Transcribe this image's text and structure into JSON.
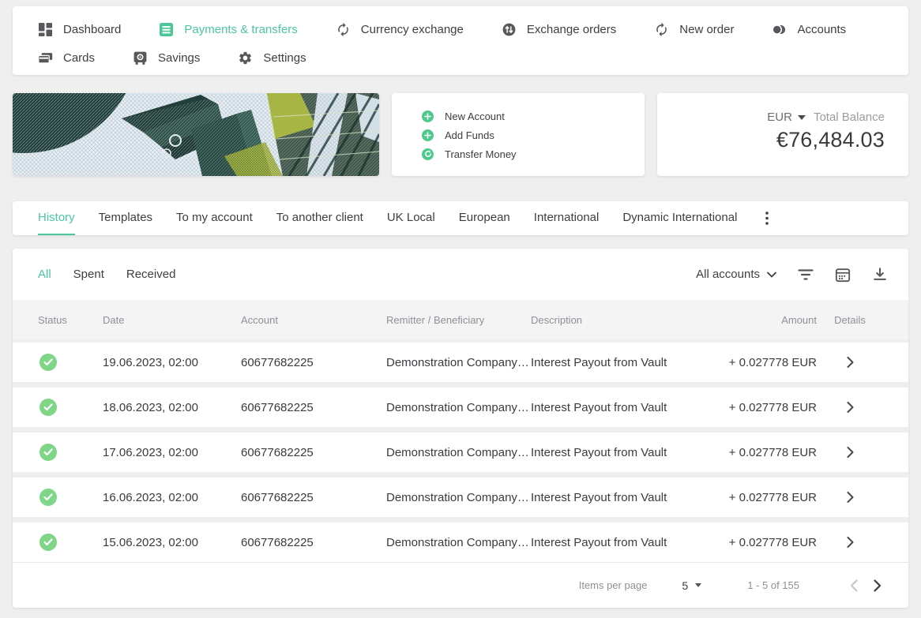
{
  "colors": {
    "accent_green": "#4cc6a0",
    "status_green": "#7fd687",
    "action_green": "#4ec98f",
    "dark_text": "#3e3e42",
    "muted_text": "#8f8f97",
    "page_bg": "#efeff0"
  },
  "nav": {
    "items": [
      {
        "label": "Dashboard",
        "icon": "dashboard-icon",
        "active": false
      },
      {
        "label": "Payments & transfers",
        "icon": "payments-icon",
        "active": true
      },
      {
        "label": "Currency exchange",
        "icon": "currency-exchange-icon",
        "active": false
      },
      {
        "label": "Exchange orders",
        "icon": "exchange-orders-icon",
        "active": false
      },
      {
        "label": "New order",
        "icon": "new-order-icon",
        "active": false
      },
      {
        "label": "Accounts",
        "icon": "accounts-icon",
        "active": false
      },
      {
        "label": "Cards",
        "icon": "cards-icon",
        "active": false
      },
      {
        "label": "Savings",
        "icon": "savings-icon",
        "active": false
      },
      {
        "label": "Settings",
        "icon": "settings-icon",
        "active": false
      }
    ]
  },
  "quick_actions": {
    "items": [
      {
        "label": "New Account",
        "icon": "plus-circle-icon"
      },
      {
        "label": "Add Funds",
        "icon": "plus-circle-icon"
      },
      {
        "label": "Transfer Money",
        "icon": "transfer-circle-icon"
      }
    ]
  },
  "balance": {
    "currency": "EUR",
    "label": "Total Balance",
    "amount": "€76,484.03"
  },
  "tabs": {
    "active": "History",
    "items": [
      "History",
      "Templates",
      "To my account",
      "To another client",
      "UK Local",
      "European",
      "International",
      "Dynamic International"
    ]
  },
  "filters": {
    "active": "All",
    "items": [
      "All",
      "Spent",
      "Received"
    ],
    "account_selector": "All accounts"
  },
  "table": {
    "columns": [
      "Status",
      "Date",
      "Account",
      "Remitter / Beneficiary",
      "Description",
      "Amount",
      "Details"
    ],
    "rows": [
      {
        "status": "completed",
        "date": "19.06.2023, 02:00",
        "account": "60677682225",
        "remitter": "Demonstration Company…",
        "description": "Interest Payout from Vault",
        "amount": "+ 0.027778 EUR"
      },
      {
        "status": "completed",
        "date": "18.06.2023, 02:00",
        "account": "60677682225",
        "remitter": "Demonstration Company…",
        "description": "Interest Payout from Vault",
        "amount": "+ 0.027778 EUR"
      },
      {
        "status": "completed",
        "date": "17.06.2023, 02:00",
        "account": "60677682225",
        "remitter": "Demonstration Company…",
        "description": "Interest Payout from Vault",
        "amount": "+ 0.027778 EUR"
      },
      {
        "status": "completed",
        "date": "16.06.2023, 02:00",
        "account": "60677682225",
        "remitter": "Demonstration Company…",
        "description": "Interest Payout from Vault",
        "amount": "+ 0.027778 EUR"
      },
      {
        "status": "completed",
        "date": "15.06.2023, 02:00",
        "account": "60677682225",
        "remitter": "Demonstration Company…",
        "description": "Interest Payout from Vault",
        "amount": "+ 0.027778 EUR"
      }
    ]
  },
  "pagination": {
    "items_per_page_label": "Items per page",
    "items_per_page": "5",
    "range": "1 - 5 of 155"
  }
}
